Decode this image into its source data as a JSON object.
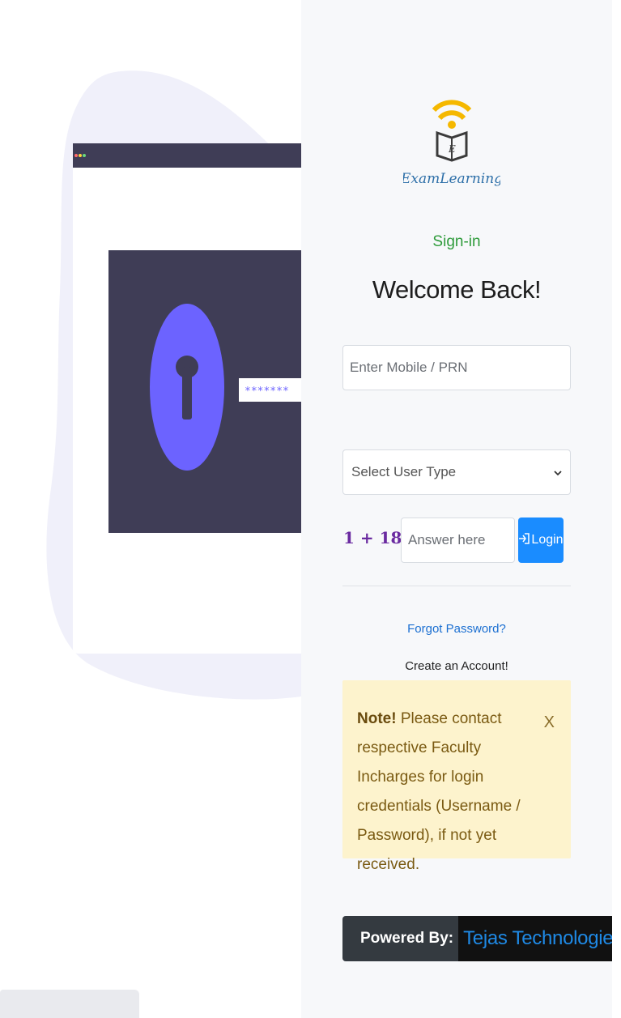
{
  "brand": {
    "logo_text": "ExamLearning"
  },
  "form": {
    "signin_label": "Sign-in",
    "welcome": "Welcome Back!",
    "mobile_placeholder": "Enter Mobile / PRN",
    "user_type_selected": "Select User Type",
    "captcha_question": "1 + 18 =",
    "answer_placeholder": "Answer here",
    "login_label": "Login"
  },
  "links": {
    "forgot_password": "Forgot Password?",
    "create_account": "Create an Account!"
  },
  "note": {
    "heading": "Note!",
    "text": " Please contact respective Faculty Incharges for login credentials (Username / Password), if not yet received.",
    "close": "X"
  },
  "footer": {
    "powered_by": "Powered By:",
    "company": "Tejas Technologies"
  },
  "illustration": {
    "password_mask": "*******"
  },
  "icons": {
    "login": "login-icon",
    "dropdown": "chevron-down-icon",
    "close": "close-icon",
    "logo": "book-wifi-icon"
  },
  "colors": {
    "accent": "#1a8cff",
    "signin": "#2e9b3a",
    "captcha": "#6a2aa0",
    "note_bg": "#fdf3cd",
    "illustration_dark": "#3f3d56",
    "illustration_purple": "#6c63ff"
  }
}
